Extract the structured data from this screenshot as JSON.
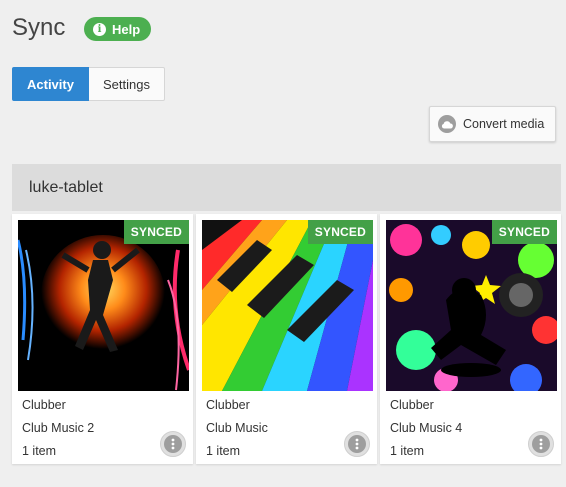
{
  "header": {
    "title": "Sync",
    "help_label": "Help"
  },
  "tabs": [
    {
      "label": "Activity",
      "active": true
    },
    {
      "label": "Settings",
      "active": false
    }
  ],
  "toolbar": {
    "convert_label": "Convert media",
    "convert_icon": "cloud-icon"
  },
  "device": {
    "name": "luke-tablet",
    "items": [
      {
        "status": "SYNCED",
        "source": "Clubber",
        "title": "Club Music 2",
        "count": "1 item"
      },
      {
        "status": "SYNCED",
        "source": "Clubber",
        "title": "Club Music",
        "count": "1 item"
      },
      {
        "status": "SYNCED",
        "source": "Clubber",
        "title": "Club Music 4",
        "count": "1 item"
      }
    ]
  },
  "colors": {
    "accent": "#2e86d1",
    "help_green": "#4caf50",
    "synced_green": "#43a047",
    "background": "#efefef",
    "device_header": "#dcdcdc"
  }
}
